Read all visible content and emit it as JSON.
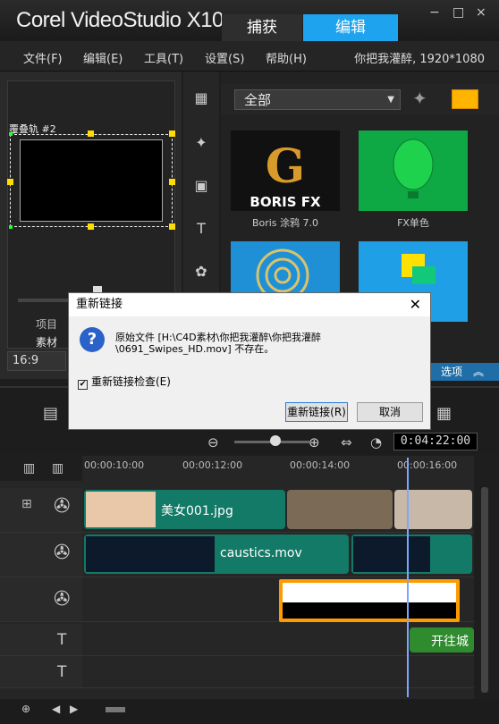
{
  "app": {
    "title": "Corel VideoStudio X10"
  },
  "header": {
    "tabs": [
      {
        "label": "捕获"
      },
      {
        "label": "编辑"
      }
    ]
  },
  "window": {
    "minimize": "−",
    "maximize": "□",
    "close": "×"
  },
  "menu": {
    "items": [
      {
        "label": "文件(F)"
      },
      {
        "label": "编辑(E)"
      },
      {
        "label": "工具(T)"
      },
      {
        "label": "设置(S)"
      },
      {
        "label": "帮助(H)"
      }
    ],
    "project_info": "你把我灌醉, 1920*1080"
  },
  "preview": {
    "overlay_label": "覆叠轨 #2",
    "project_label": "项目",
    "material_label": "素材",
    "aspect": "16:9"
  },
  "library": {
    "category": "全部",
    "tiles": [
      {
        "label": "Boris 涂鸦 7.0"
      },
      {
        "label": "FX单色"
      }
    ],
    "options_label": "选项"
  },
  "timeline": {
    "timecode": "0:04:22:00",
    "ruler": [
      "00:00:10:00",
      "00:00:12:00",
      "00:00:14:00",
      "00:00:16:00"
    ],
    "clips": {
      "video1": "美女001.jpg",
      "overlay1": "caustics.mov",
      "title1": "开往城"
    }
  },
  "dialog": {
    "title": "重新链接",
    "message": "原始文件 [H:\\C4D素材\\你把我灌醉\\你把我灌醉\\0691_Swipes_HD.mov] 不存在。",
    "check_label": "重新链接检查(E)",
    "relink_button": "重新链接(R)",
    "cancel_button": "取消"
  }
}
